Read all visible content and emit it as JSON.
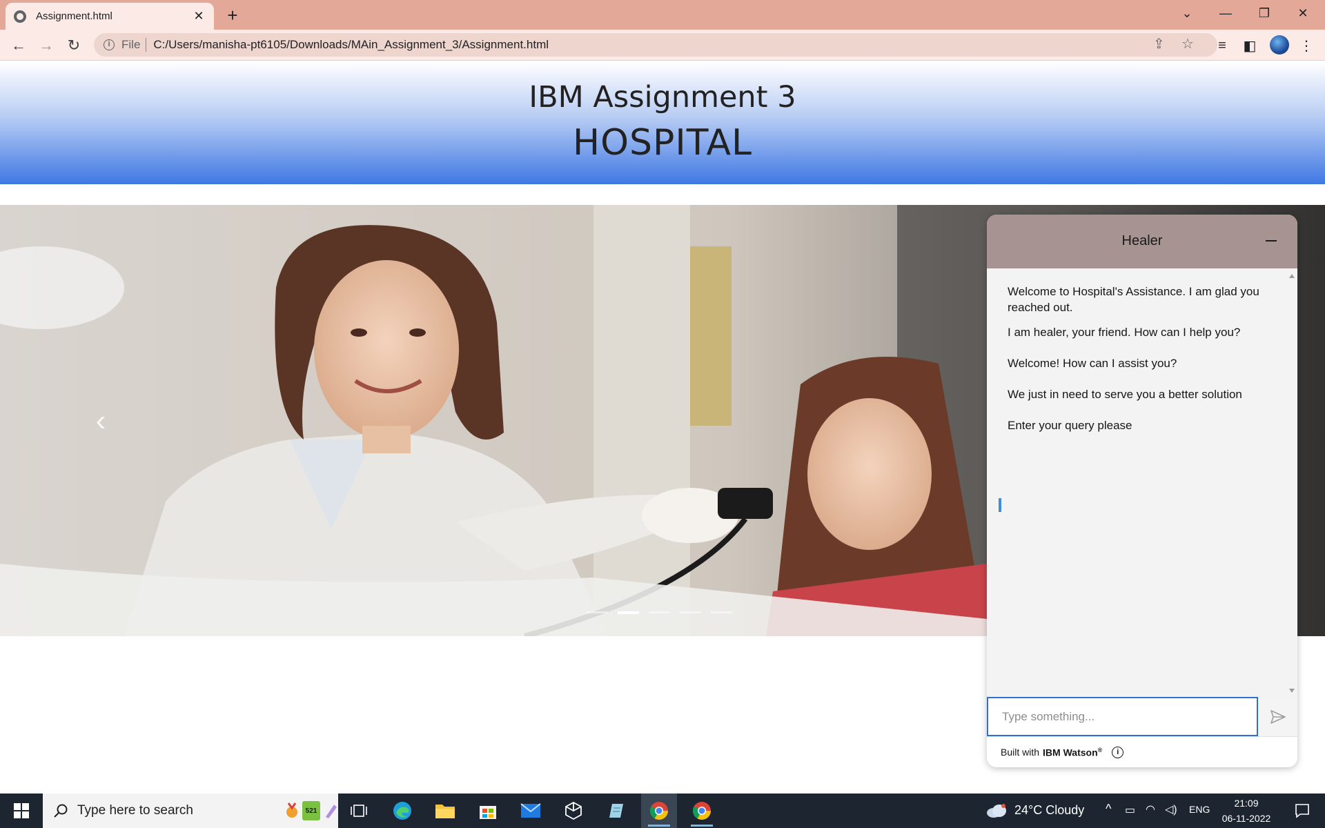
{
  "browser": {
    "tab_title": "Assignment.html",
    "tab_close": "✕",
    "new_tab": "+",
    "url_scheme_label": "File",
    "url": "C:/Users/manisha-pt6105/Downloads/MAin_Assignment_3/Assignment.html"
  },
  "page": {
    "subtitle": "IBM Assignment 3",
    "title": "HOSPITAL"
  },
  "carousel": {
    "prev_arrow": "‹",
    "slide_count": 5,
    "active_index": 1
  },
  "chat": {
    "title": "Healer",
    "messages": [
      "Welcome to Hospital's Assistance. I am glad you reached out.",
      "I am healer, your friend. How can I help you?",
      "Welcome! How can I assist you?",
      "We just in need to serve you a better solution",
      "Enter your query please"
    ],
    "input_placeholder": "Type something...",
    "footer_prefix": "Built with",
    "footer_brand": "IBM Watson",
    "footer_reg": "®",
    "info_glyph": "i"
  },
  "taskbar": {
    "search_placeholder": "Type here to search",
    "weather": "24°C  Cloudy",
    "language": "ENG",
    "time": "21:09",
    "date": "06-11-2022",
    "badge_count": "521"
  },
  "colors": {
    "header_gradient_bottom": "#3f78e3",
    "chat_header": "#a79392",
    "accent_blue": "#2f6fd8",
    "taskbar": "#1c2530",
    "tabbar": "#e4a898"
  }
}
